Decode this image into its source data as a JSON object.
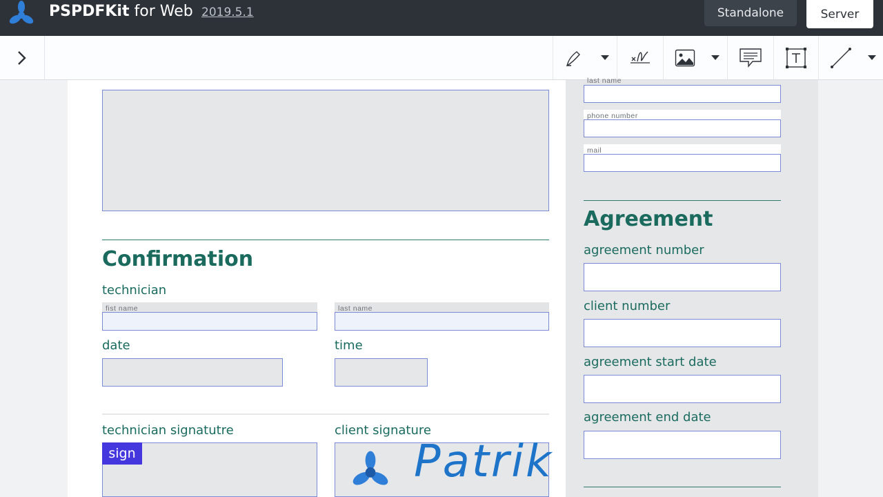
{
  "header": {
    "app_name_bold": "PSPDFKit",
    "app_name_rest": " for Web",
    "version": "2019.5.1",
    "standalone_label": "Standalone",
    "server_label": "Server"
  },
  "toolbar": {
    "tools": [
      "ink-annotation",
      "signature",
      "image-annotation",
      "note-annotation",
      "text-annotation",
      "line-annotation"
    ]
  },
  "colors": {
    "accent": "#1a6b5e",
    "field_border": "#7b8ad6",
    "sign_button": "#4537de",
    "signature_ink": "#1d74c9"
  },
  "form": {
    "confirmation_heading": "Confirmation",
    "technician_label": "technician",
    "first_name_hint": "fist name",
    "last_name_hint": "last name",
    "date_label": "date",
    "time_label": "time",
    "technician_signature_label": "technician signatutre",
    "client_signature_label": "client signature",
    "sign_button": "sign",
    "client_signature_text": "Patrik"
  },
  "panel": {
    "last_name_hint": "last name",
    "phone_hint": "phone number",
    "mail_hint": "mail",
    "agreement_heading": "Agreement",
    "agreement_number_label": "agreement number",
    "client_number_label": "client number",
    "agreement_start_label": "agreement start date",
    "agreement_end_label": "agreement end date"
  }
}
